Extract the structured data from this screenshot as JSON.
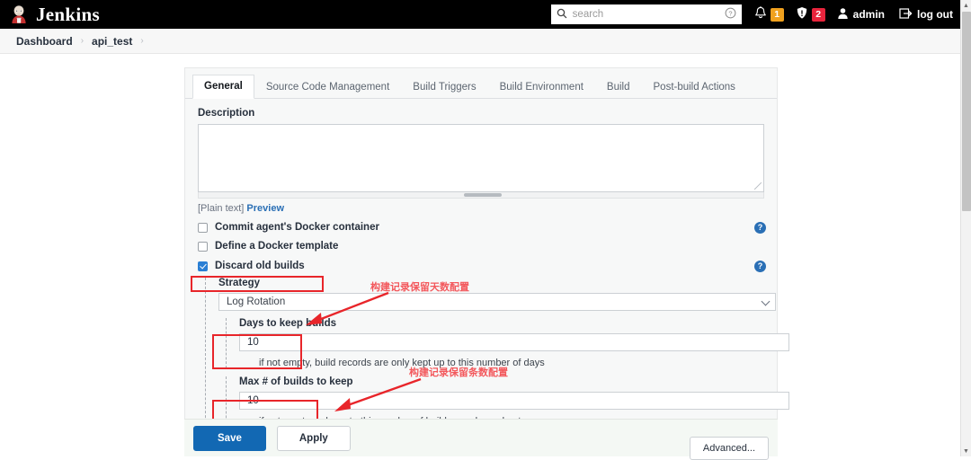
{
  "header": {
    "brand": "Jenkins",
    "logo_icon": "jenkins-butler-icon",
    "search": {
      "placeholder": "search",
      "value": "",
      "icon": "search-icon",
      "help_icon": "help-circle-icon"
    },
    "notifications": {
      "icon": "bell-icon",
      "count": "1",
      "color": "#f0a11e"
    },
    "security": {
      "icon": "shield-alert-icon",
      "count": "2",
      "color": "#e8243c"
    },
    "user": {
      "icon": "person-icon",
      "label": "admin"
    },
    "logout": {
      "icon": "logout-icon",
      "label": "log out"
    }
  },
  "breadcrumb": {
    "items": [
      "Dashboard",
      "api_test"
    ],
    "separator": "›"
  },
  "tabs": [
    {
      "label": "General",
      "active": true
    },
    {
      "label": "Source Code Management",
      "active": false
    },
    {
      "label": "Build Triggers",
      "active": false
    },
    {
      "label": "Build Environment",
      "active": false
    },
    {
      "label": "Build",
      "active": false
    },
    {
      "label": "Post-build Actions",
      "active": false
    }
  ],
  "form": {
    "description": {
      "label": "Description",
      "value": "",
      "plain_text_note": "[Plain text]",
      "preview_link": "Preview"
    },
    "checkboxes": [
      {
        "label": "Commit agent's Docker container",
        "checked": false,
        "has_help": true
      },
      {
        "label": "Define a Docker template",
        "checked": false,
        "has_help": false
      },
      {
        "label": "Discard old builds",
        "checked": true,
        "has_help": true,
        "highlighted": true
      }
    ],
    "strategy": {
      "label": "Strategy",
      "selected": "Log Rotation",
      "days_to_keep": {
        "label": "Days to keep builds",
        "value": "10",
        "hint": "if not empty, build records are only kept up to this number of days"
      },
      "max_builds": {
        "label": "Max # of builds to keep",
        "value": "10",
        "hint": "if not empty, only up to this number of build records are kept"
      }
    }
  },
  "annotations": [
    {
      "text": "构建记录保留天数配置",
      "color": "#f3585c"
    },
    {
      "text": "构建记录保留条数配置",
      "color": "#f3585c"
    }
  ],
  "footer": {
    "save_label": "Save",
    "apply_label": "Apply",
    "advanced_label": "Advanced...",
    "save_color": "#1268b3"
  },
  "scrollbar": {
    "up_glyph": "▲",
    "down_glyph": "▼"
  }
}
